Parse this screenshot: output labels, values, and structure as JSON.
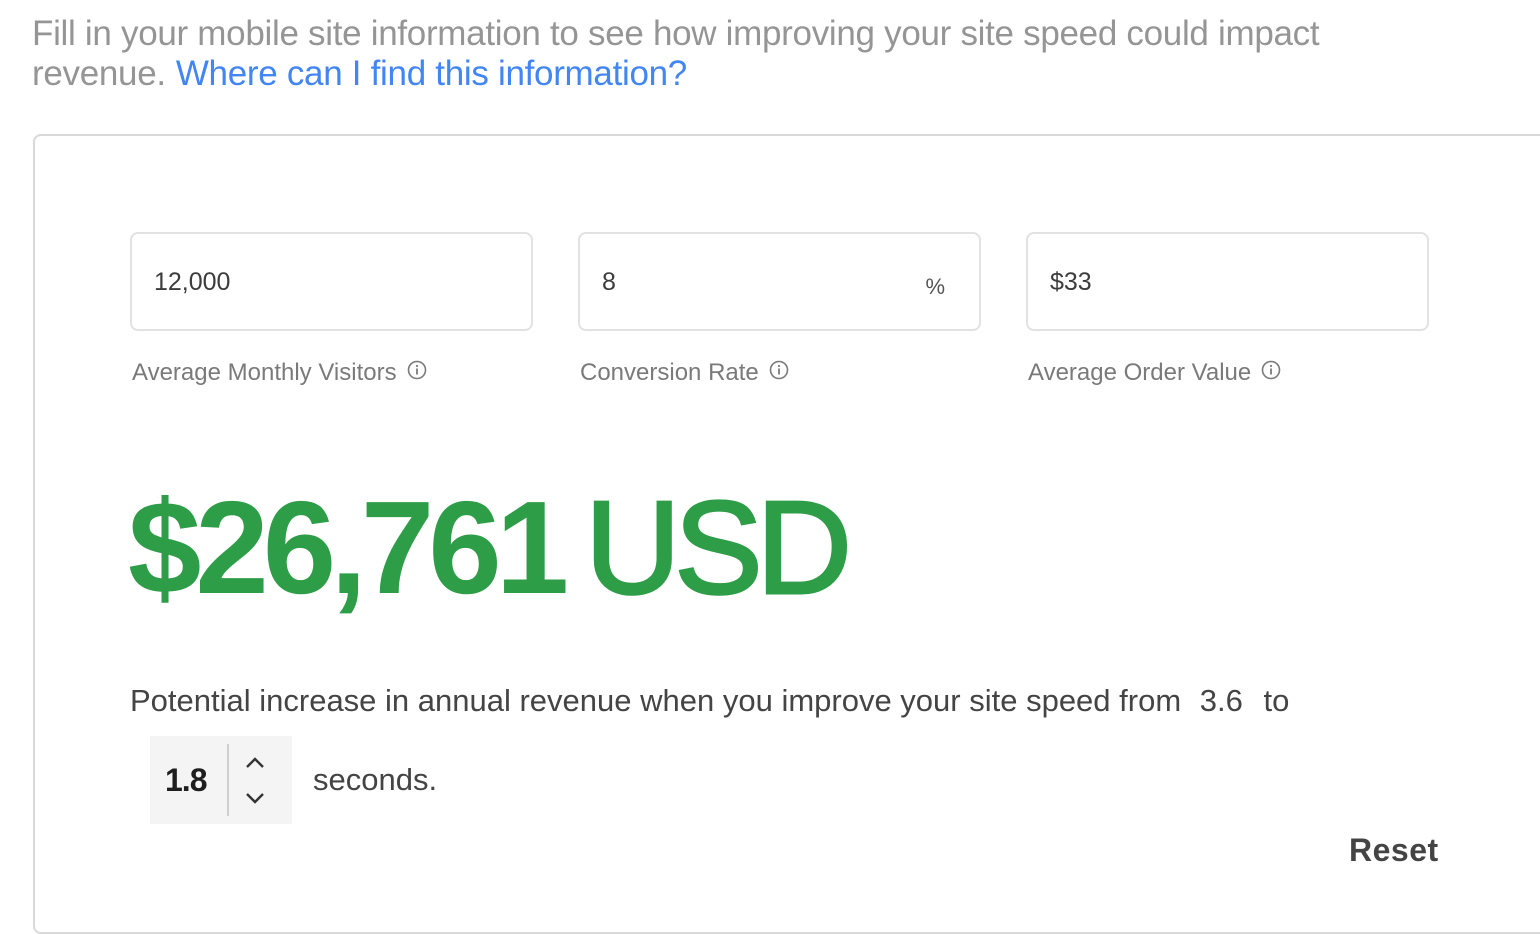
{
  "intro": {
    "text": "Fill in your mobile site information to see how improving your site speed could impact revenue.",
    "link_label": "Where can I find this information?"
  },
  "colors": {
    "accent_green": "#2e9d47",
    "link_blue": "#4285f4"
  },
  "fields": [
    {
      "value": "12,000",
      "suffix": "",
      "label": "Average Monthly Visitors",
      "icon": "info-icon"
    },
    {
      "value": "8",
      "suffix": "%",
      "label": "Conversion Rate",
      "icon": "info-icon"
    },
    {
      "value": "$33",
      "suffix": "",
      "label": "Average Order Value",
      "icon": "info-icon"
    }
  ],
  "result": {
    "amount": "$26,761",
    "currency": "USD"
  },
  "sentence": {
    "text": "Potential increase in annual revenue when you improve your site speed from",
    "from_value": "3.6",
    "to_label": "to",
    "seconds_label": "seconds."
  },
  "stepper": {
    "value": "1.8",
    "up_icon": "chevron-up-icon",
    "down_icon": "chevron-down-icon"
  },
  "actions": {
    "reset_label": "Reset"
  }
}
